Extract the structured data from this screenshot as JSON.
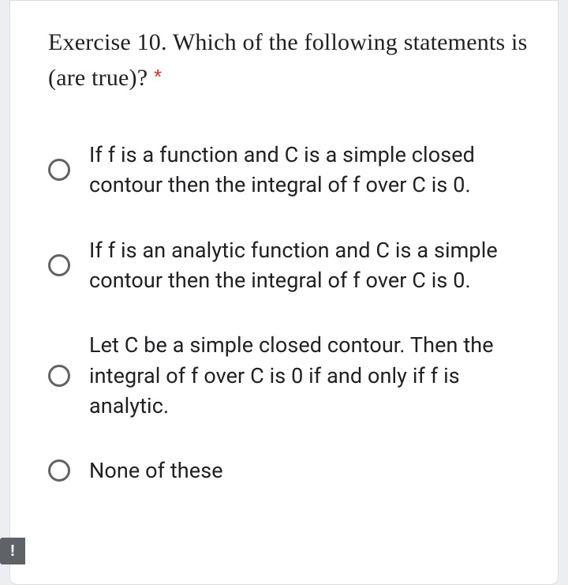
{
  "question": {
    "title": "Exercise 10. Which of the following statements is (are true)?",
    "required_marker": "*"
  },
  "options": [
    {
      "label": "If f is a function and C is a simple closed contour then the integral of f over C is 0."
    },
    {
      "label": "If f is an analytic function and C is a simple contour then the integral of f over C is 0."
    },
    {
      "label": "Let C be a simple closed contour. Then the integral of f over C is 0 if and only if f is analytic."
    },
    {
      "label": "None of these"
    }
  ],
  "footer_icon": {
    "glyph": "!",
    "semantic": "report-problem-icon"
  }
}
